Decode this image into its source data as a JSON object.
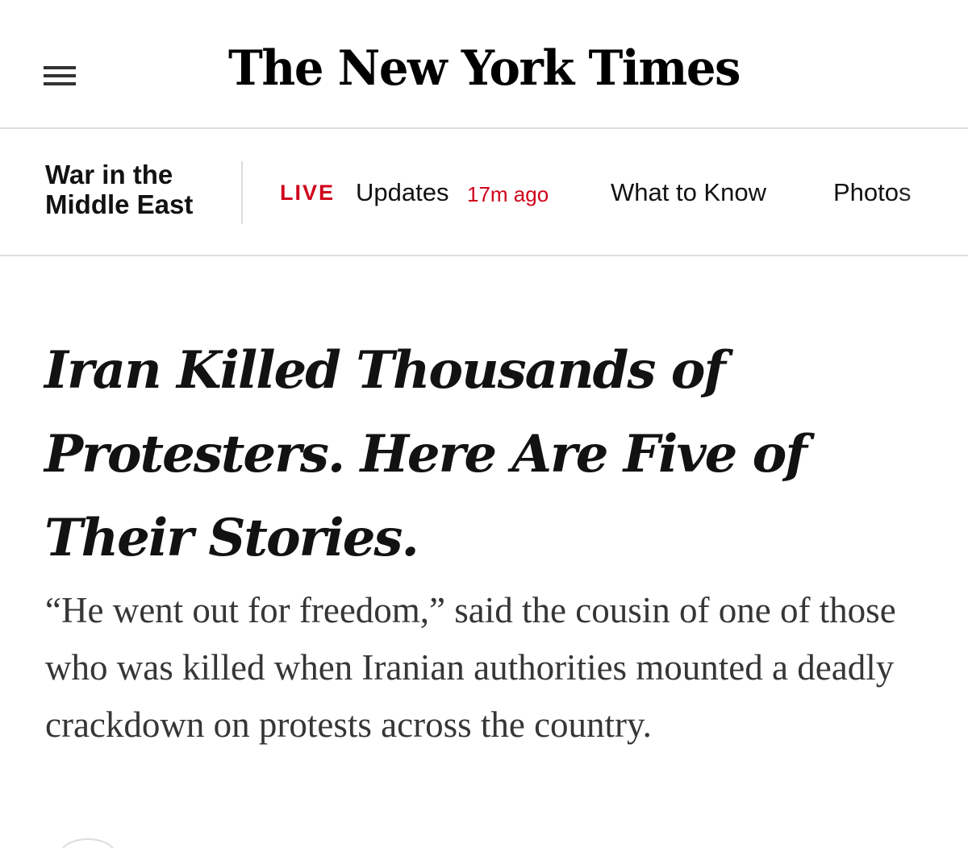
{
  "header": {
    "menu_icon": "hamburger-menu-icon",
    "masthead": "The New York Times"
  },
  "section_nav": {
    "section_title": "War in the Middle East",
    "live_label": "LIVE",
    "updates_label": "Updates",
    "updated_ago": "17m ago",
    "what_to_know_label": "What to Know",
    "photos_label": "Photos"
  },
  "article": {
    "headline": "Iran Killed Thousands of Protesters. Here Are Five of Their Stories.",
    "summary": "“He went out for freedom,” said the cousin of one of those who was killed when Iranian authorities mounted a deadly crackdown on protests across the country."
  },
  "colors": {
    "live_red": "#d0021b",
    "text": "#121212",
    "summary_text": "#363636",
    "divider": "#dedede"
  }
}
